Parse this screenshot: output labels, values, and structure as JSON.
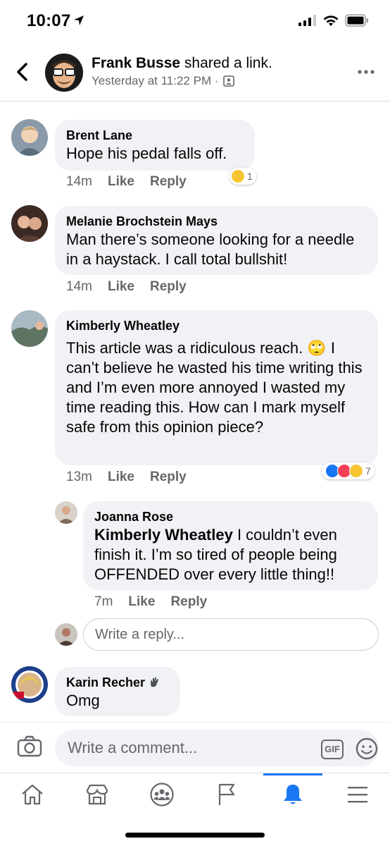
{
  "status_bar": {
    "time": "10:07"
  },
  "header": {
    "author": "Frank Busse",
    "action": " shared a link.",
    "timestamp": "Yesterday at 11:22 PM ·"
  },
  "comments": [
    {
      "name": "Brent Lane",
      "text": "Hope his pedal falls off.",
      "time": "14m",
      "like": "Like",
      "reply": "Reply",
      "reactions_count": "1"
    },
    {
      "name": "Melanie Brochstein Mays",
      "text": "Man there’s someone looking for a needle in a haystack. I call total bullshit!",
      "time": "14m",
      "like": "Like",
      "reply": "Reply"
    },
    {
      "name": "Kimberly Wheatley",
      "text": "This article was a ridiculous reach. 🙄 I can’t believe he wasted his time writing this and I’m even more annoyed I wasted my time reading this.  How can I mark myself safe from this opinion piece?",
      "time": "13m",
      "like": "Like",
      "reply": "Reply",
      "reactions_count": "7"
    },
    {
      "name": "Joanna Rose",
      "mention": "Kimberly Wheatley",
      "text": " I couldn’t even finish it. I’m so tired of people being OFFENDED over every little thing!!",
      "time": "7m",
      "like": "Like",
      "reply": "Reply"
    },
    {
      "name": "Karin Recher",
      "text": "Omg"
    }
  ],
  "reply_input": {
    "placeholder": "Write a reply..."
  },
  "composer": {
    "placeholder": "Write a comment...",
    "gif_label": "GIF"
  },
  "tabs": [
    {
      "name": "home",
      "icon": "home-icon"
    },
    {
      "name": "marketplace",
      "icon": "marketplace-icon"
    },
    {
      "name": "groups",
      "icon": "groups-icon"
    },
    {
      "name": "pages",
      "icon": "flag-icon"
    },
    {
      "name": "notifications",
      "icon": "bell-icon",
      "active": true
    },
    {
      "name": "menu",
      "icon": "menu-icon"
    }
  ],
  "colors": {
    "accent": "#1877f2",
    "bubble": "#f0f2f5",
    "meta": "#65676b"
  }
}
